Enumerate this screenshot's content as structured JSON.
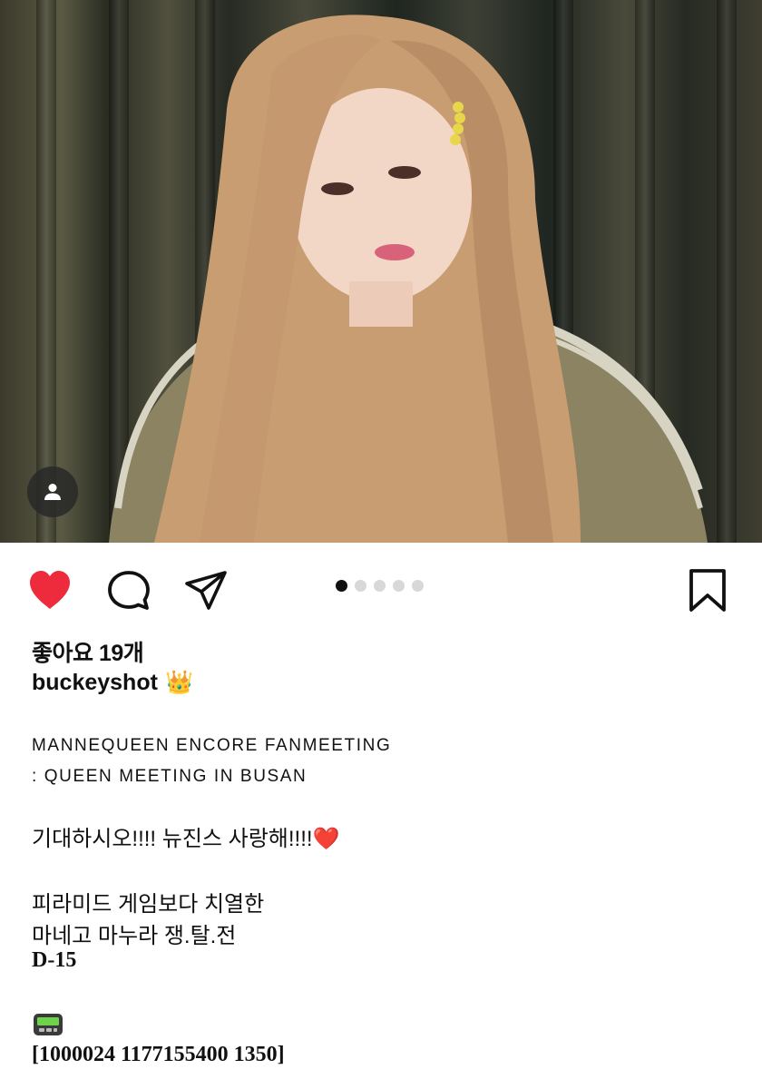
{
  "post": {
    "likes_label": "좋아요 19개",
    "username": "buckeyshot",
    "username_emoji": "👑",
    "caption_line1": "MANNEQUEEN ENCORE FANMEETING",
    "caption_line2": ": QUEEN MEETING IN BUSAN",
    "caption_line3": "기대하시오!!!! 뉴진스 사랑해!!!!",
    "caption_line3_emoji": "❤️",
    "caption_line4": "피라미드 게임보다 치열한",
    "caption_line5": "마네고 마누라 쟁.탈.전",
    "caption_dday": "D-15",
    "pager_icon": "pager-icon",
    "caption_code": "[1000024 1177155400 1350]"
  },
  "carousel": {
    "total": 5,
    "active_index": 0
  },
  "icons": {
    "like": "heart-icon",
    "comment": "comment-icon",
    "share": "send-icon",
    "bookmark": "bookmark-icon",
    "user_tag": "user-tag-icon"
  },
  "colors": {
    "like_active": "#ed2b3c",
    "dot_active": "#111111",
    "dot_inactive": "#d8d8d8"
  }
}
